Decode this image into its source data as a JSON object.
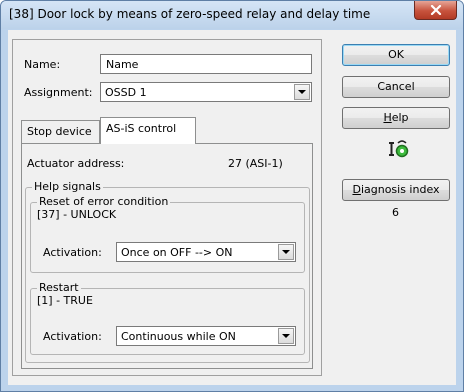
{
  "window": {
    "title": "[38] Door lock by means of zero-speed relay and delay time"
  },
  "form": {
    "name_label": "Name:",
    "name_value": "Name",
    "assignment_label": "Assignment:",
    "assignment_value": "OSSD 1"
  },
  "tabs": [
    {
      "label": "Stop device",
      "active": false
    },
    {
      "label": "AS-iS control",
      "active": true
    }
  ],
  "as_control": {
    "actuator_address_label": "Actuator address:",
    "actuator_address_value": "27 (ASI-1)",
    "help_signals_title": "Help signals",
    "reset_group": {
      "title": "Reset of error condition",
      "signal": "[37] - UNLOCK",
      "activation_label": "Activation:",
      "activation_value": "Once on OFF --> ON"
    },
    "restart_group": {
      "title": "Restart",
      "signal": "[1] - TRUE",
      "activation_label": "Activation:",
      "activation_value": "Continuous while ON"
    }
  },
  "buttons": {
    "ok": "OK",
    "cancel": "Cancel",
    "help_first": "H",
    "help_rest": "elp",
    "diagnosis_first": "D",
    "diagnosis_rest": "iagnosis index"
  },
  "diagnosis_index_value": "6",
  "icons": {
    "close": "close-icon",
    "status": "actuator-status-icon"
  }
}
